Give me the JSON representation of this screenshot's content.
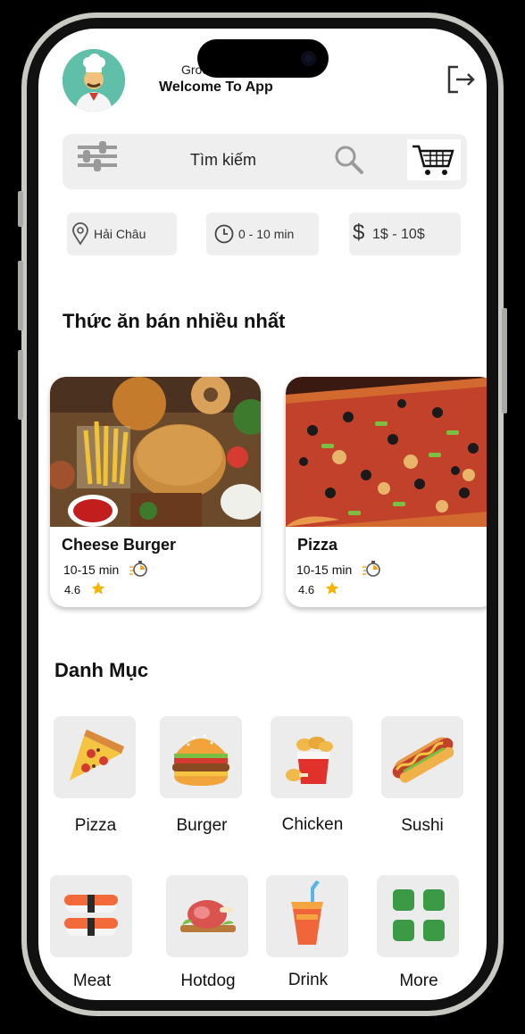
{
  "header": {
    "greeting": "Grocery",
    "welcome": "Welcome To App"
  },
  "search": {
    "placeholder": "Tìm kiếm"
  },
  "filters": {
    "location": "Hải Châu",
    "time": "0 - 10 min",
    "price": "1$ - 10$"
  },
  "best_selling": {
    "title": "Thức ăn bán nhiều nhất",
    "items": [
      {
        "name": "Cheese Burger",
        "time": "10-15 min",
        "rating": "4.6"
      },
      {
        "name": "Pizza",
        "time": "10-15 min",
        "rating": "4.6"
      }
    ]
  },
  "categories": {
    "title": "Danh Mục",
    "items": [
      {
        "label": "Pizza",
        "icon": "pizza-icon"
      },
      {
        "label": "Burger",
        "icon": "burger-icon"
      },
      {
        "label": "Chicken",
        "icon": "chicken-icon"
      },
      {
        "label": "Sushi",
        "icon": "hotdog-icon"
      },
      {
        "label": "Meat",
        "icon": "sushi-icon"
      },
      {
        "label": "Hotdog",
        "icon": "meat-icon"
      },
      {
        "label": "Drink",
        "icon": "drink-icon"
      },
      {
        "label": "More",
        "icon": "grid-icon"
      }
    ]
  },
  "colors": {
    "avatar_bg": "#5fbfa9",
    "star": "#f4b400",
    "more_green": "#3a9a45"
  }
}
